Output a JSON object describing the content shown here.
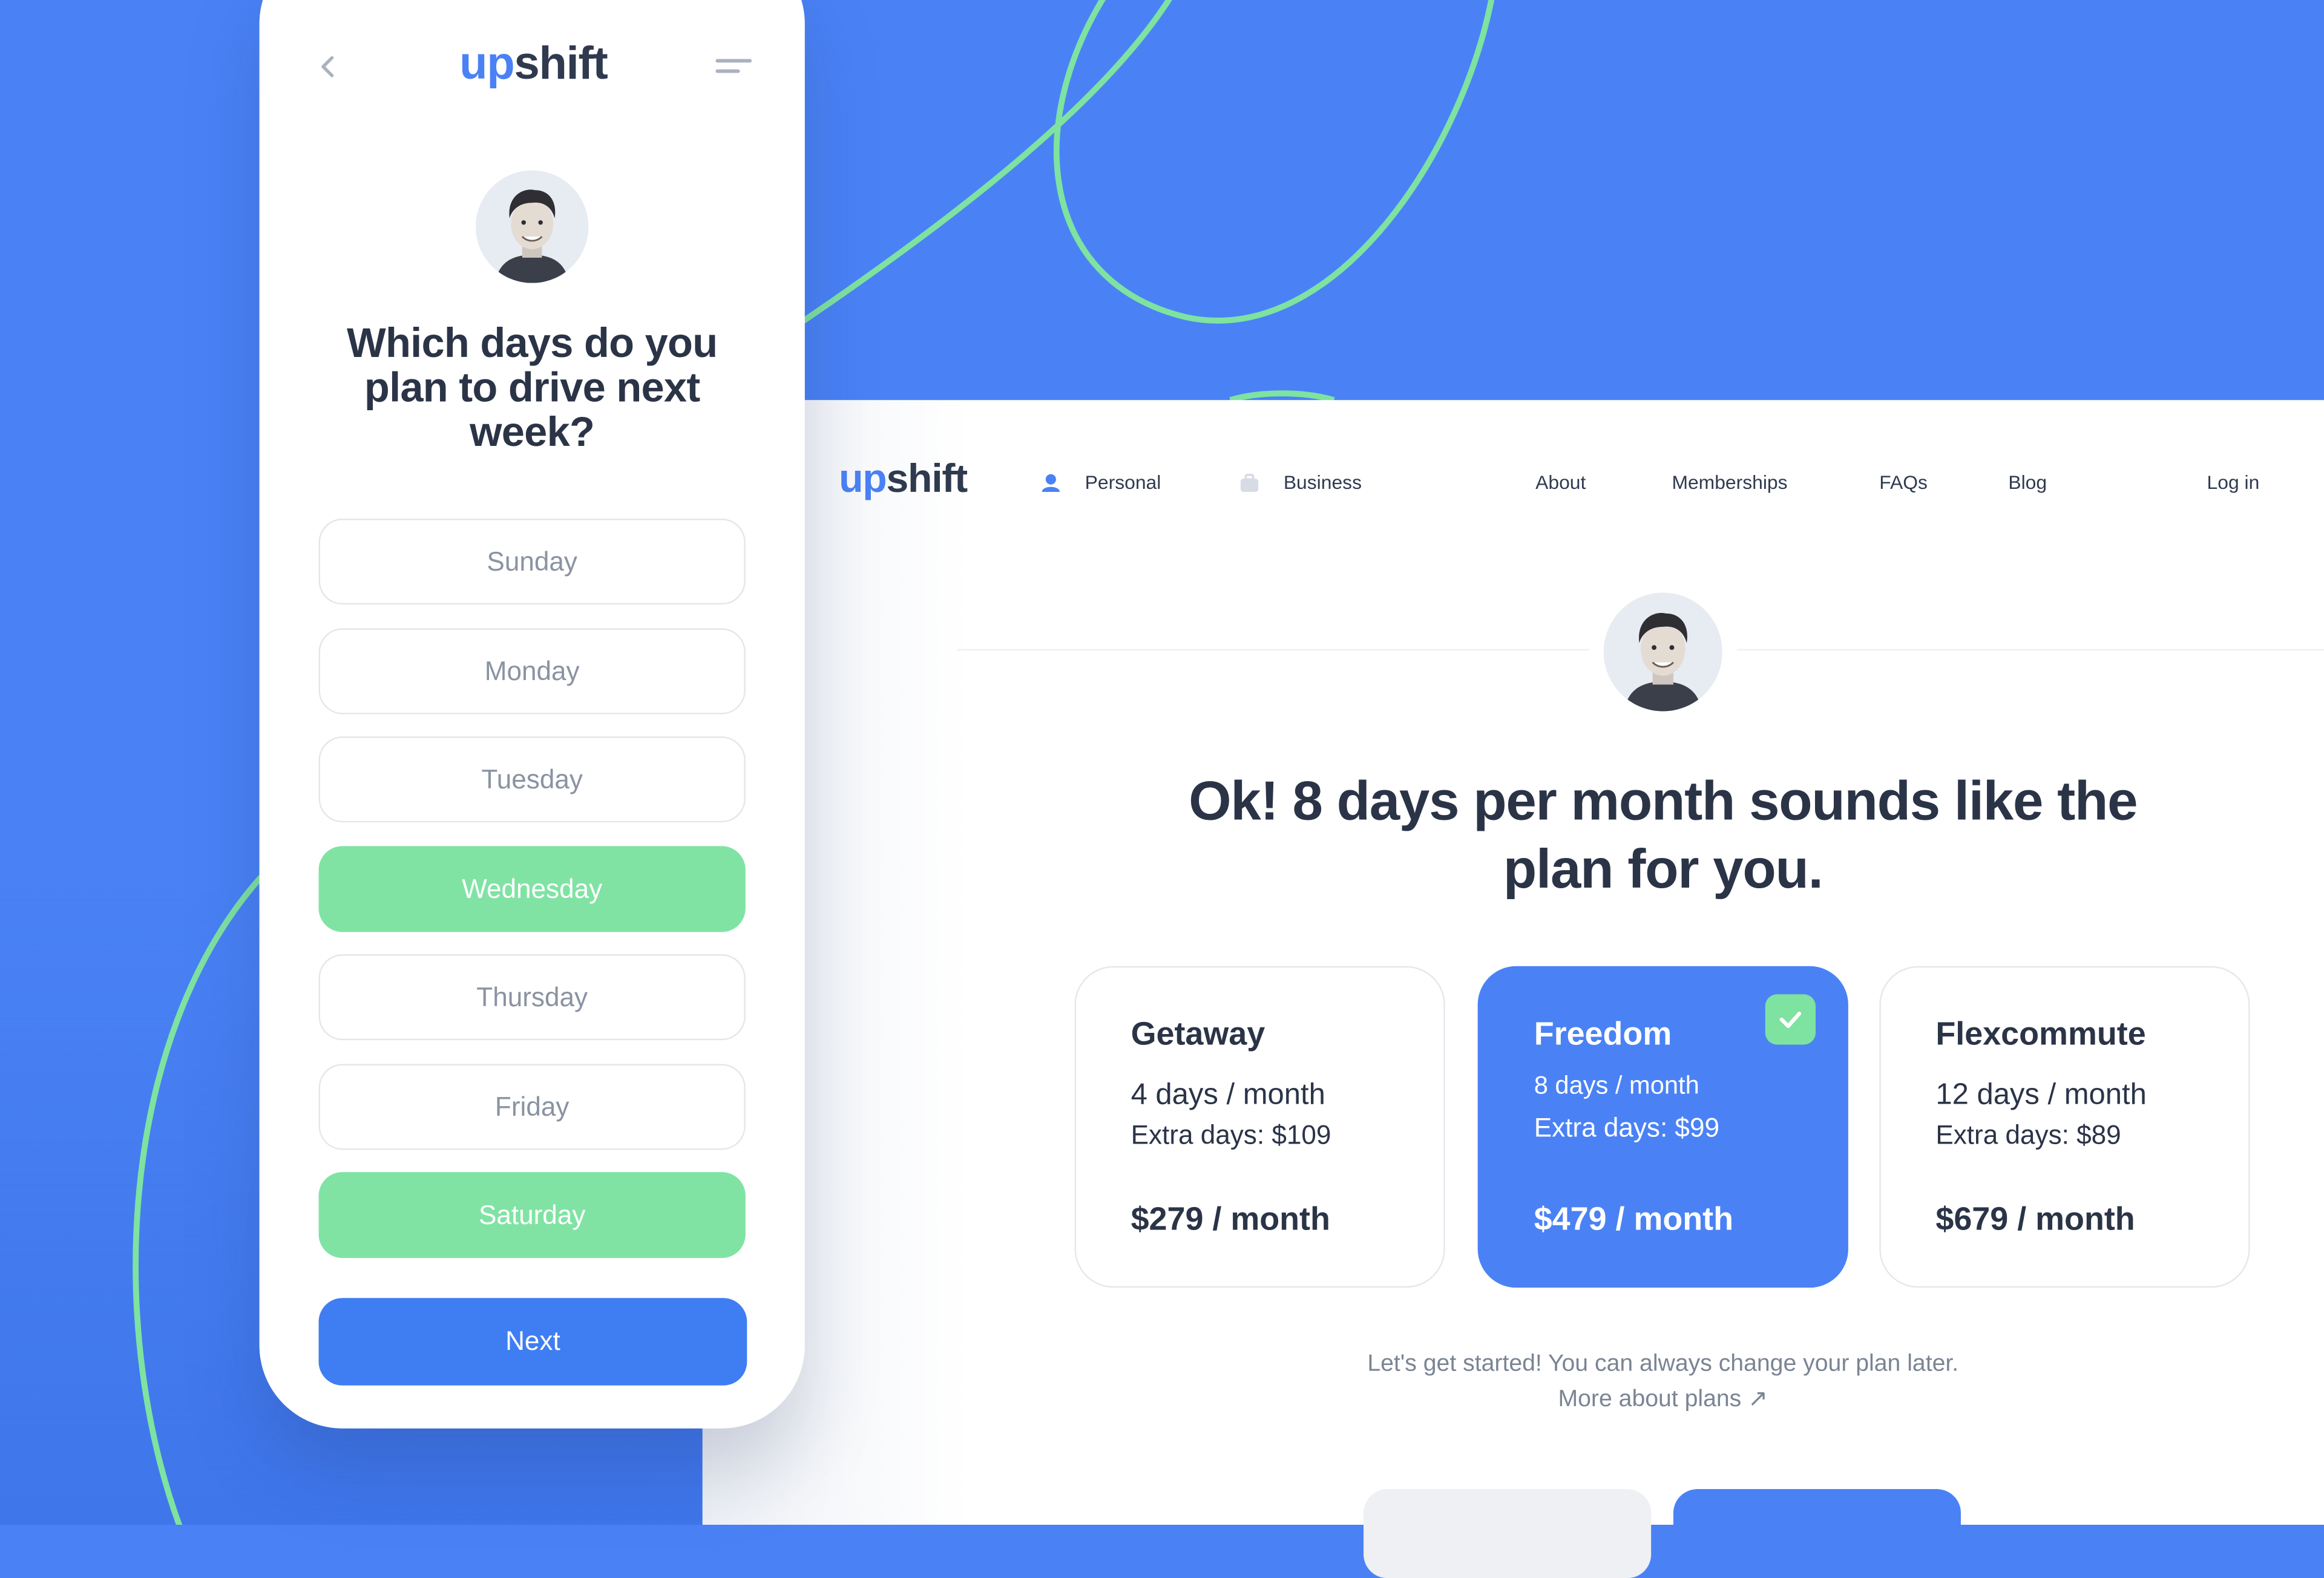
{
  "brand": {
    "prefix": "up",
    "suffix": "shift"
  },
  "mobile": {
    "back_icon": "chevron-left-icon",
    "menu_icon": "menu-icon",
    "question": "Which days do you plan to drive next week?",
    "days": [
      {
        "label": "Sunday",
        "selected": false
      },
      {
        "label": "Monday",
        "selected": false
      },
      {
        "label": "Tuesday",
        "selected": false
      },
      {
        "label": "Wednesday",
        "selected": true
      },
      {
        "label": "Thursday",
        "selected": false
      },
      {
        "label": "Friday",
        "selected": false
      },
      {
        "label": "Saturday",
        "selected": true
      }
    ],
    "next_label": "Next"
  },
  "desktop": {
    "nav": {
      "personal": "Personal",
      "business": "Business",
      "about": "About",
      "memberships": "Memberships",
      "faqs": "FAQs",
      "blog": "Blog",
      "login": "Log in"
    },
    "headline": "Ok! 8 days per month sounds like the plan for you.",
    "plans": [
      {
        "name": "Getaway",
        "days": "4 days / month",
        "extra": "Extra days: $109",
        "price": "$279 / month",
        "selected": false
      },
      {
        "name": "Freedom",
        "days": "8 days / month",
        "extra": "Extra days: $99",
        "price": "$479 / month",
        "selected": true
      },
      {
        "name": "Flexcommute",
        "days": "12 days / month",
        "extra": "Extra days: $89",
        "price": "$679 / month",
        "selected": false
      }
    ],
    "started_text": "Let's get started!  You can always change your plan later.",
    "more_link": "More about plans ↗"
  },
  "colors": {
    "background": "#4a82f5",
    "accent_blue": "#4a82f5",
    "accent_green": "#80e3a4",
    "text_dark": "#2b3447"
  }
}
